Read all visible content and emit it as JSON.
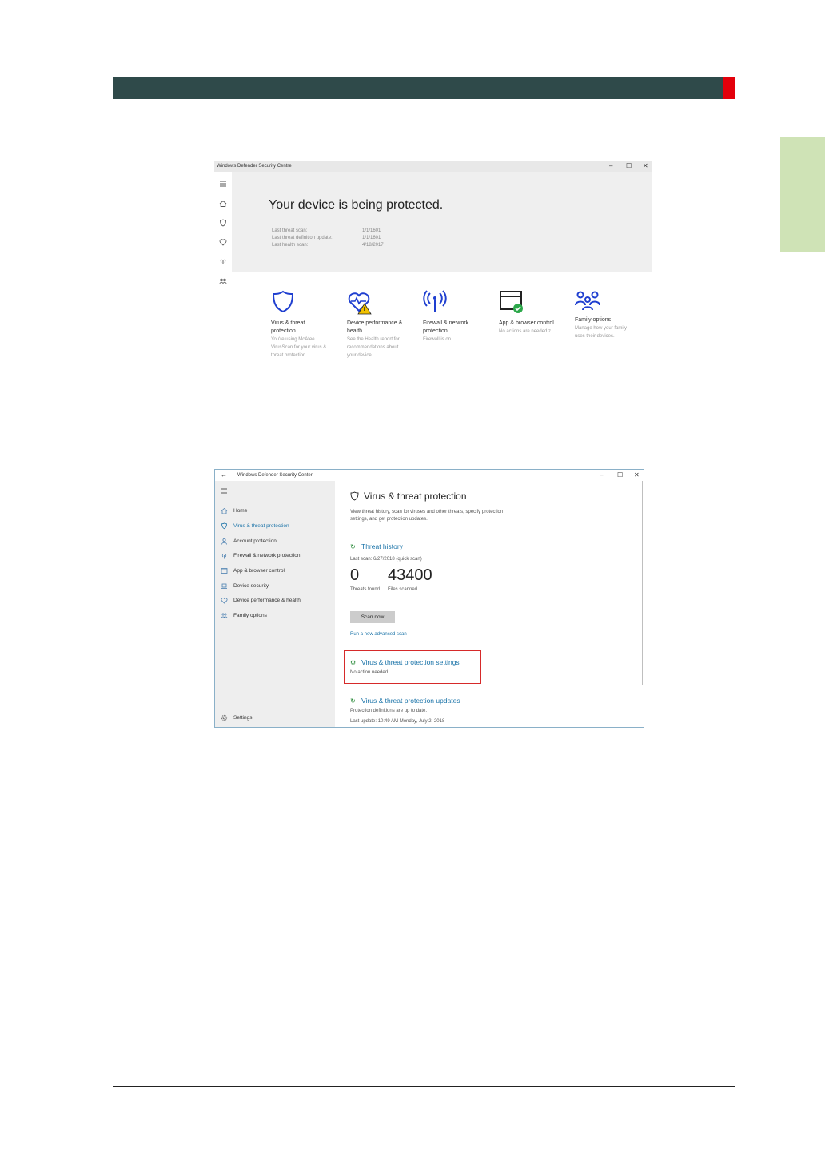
{
  "window1": {
    "title": "Windows Defender Security Centre",
    "controls": {
      "minimize": "–",
      "maximize": "☐",
      "close": "✕"
    },
    "hero_title": "Your device is being protected.",
    "scan_info": [
      {
        "label": "Last threat scan:",
        "value": "1/1/1601"
      },
      {
        "label": "Last threat definition update:",
        "value": "1/1/1601"
      },
      {
        "label": "Last health scan:",
        "value": "4/18/2017"
      }
    ],
    "tiles": [
      {
        "title": "Virus & threat protection",
        "desc": "You're using McAfee VirusScan for your virus & threat protection.",
        "icon": "shield-icon"
      },
      {
        "title": "Device performance & health",
        "desc": "See the Health report for recommendations about your device.",
        "icon": "heart-warning-icon"
      },
      {
        "title": "Firewall & network protection",
        "desc": "Firewall is on.",
        "icon": "antenna-icon"
      },
      {
        "title": "App & browser control",
        "desc": "No actions are needed.z",
        "icon": "browser-check-icon"
      },
      {
        "title": "Family options",
        "desc": "Manage how your family uses their devices.",
        "icon": "family-icon"
      }
    ]
  },
  "window2": {
    "title": "Windows Defender Security Center",
    "controls": {
      "minimize": "–",
      "maximize": "☐",
      "close": "✕"
    },
    "nav": [
      {
        "label": "Home",
        "icon": "home-icon"
      },
      {
        "label": "Virus & threat protection",
        "icon": "shield-icon",
        "active": true
      },
      {
        "label": "Account protection",
        "icon": "person-icon"
      },
      {
        "label": "Firewall & network protection",
        "icon": "antenna-icon"
      },
      {
        "label": "App & browser control",
        "icon": "browser-icon"
      },
      {
        "label": "Device security",
        "icon": "laptop-icon"
      },
      {
        "label": "Device performance & health",
        "icon": "heart-icon"
      },
      {
        "label": "Family options",
        "icon": "family-icon"
      }
    ],
    "settings_label": "Settings",
    "page_title": "Virus & threat protection",
    "page_desc_1": "View threat history, scan for viruses and other threats, specify protection",
    "page_desc_2": "settings, and get protection updates.",
    "threat_history": {
      "heading": "Threat history",
      "last_scan": "Last scan: 6/27/2018 (quick scan)",
      "threats_found_value": "0",
      "threats_found_label": "Threats found",
      "files_scanned_value": "43400",
      "files_scanned_label": "Files scanned",
      "scan_button": "Scan now",
      "advanced_link": "Run a new advanced scan"
    },
    "settings_section": {
      "heading": "Virus & threat protection settings",
      "status": "No action needed."
    },
    "updates_section": {
      "heading": "Virus & threat protection updates",
      "status": "Protection definitions are up to date.",
      "last_update": "Last update: 10:49 AM Monday, July 2, 2018"
    }
  },
  "colors": {
    "header_bar": "#2f4a4a",
    "header_accent": "#e3000b",
    "side_tab": "#cfe3b6",
    "link": "#1a73a8",
    "highlight_box": "#d62a2a"
  }
}
